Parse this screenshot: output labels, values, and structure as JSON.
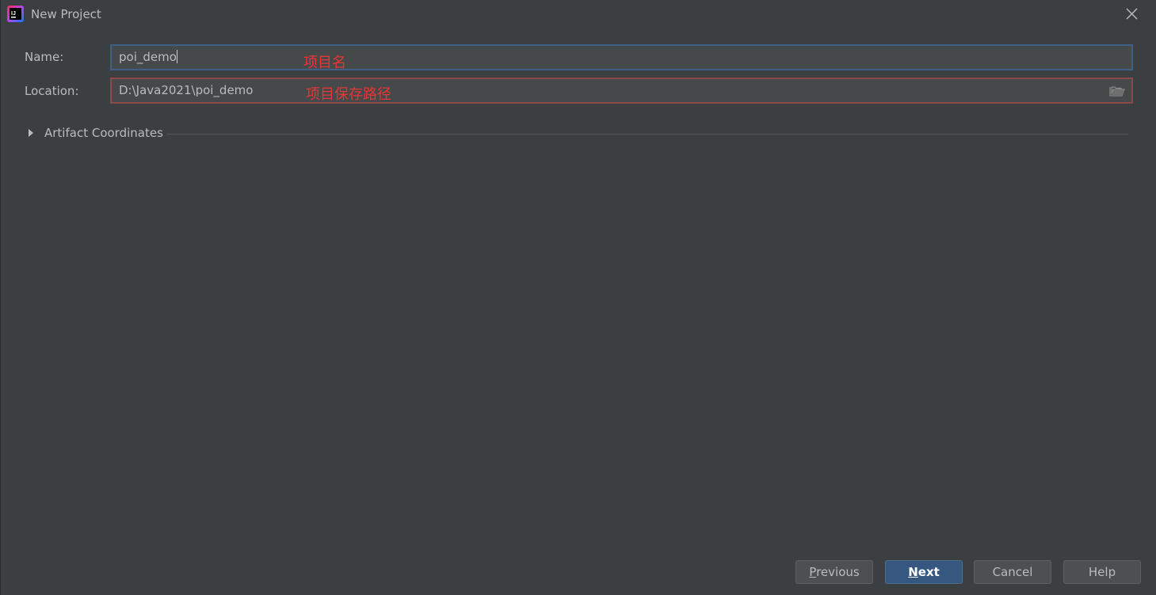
{
  "window": {
    "title": "New Project"
  },
  "form": {
    "name_label": "Name:",
    "name_value": "poi_demo",
    "name_annotation": "项目名",
    "location_label": "Location:",
    "location_value": "D:\\Java2021\\poi_demo",
    "location_annotation": "项目保存路径"
  },
  "artifact_section": {
    "label": "Artifact Coordinates",
    "expanded": false
  },
  "buttons": {
    "previous_mnemonic": "P",
    "previous_rest": "revious",
    "next_mnemonic": "N",
    "next_rest": "ext",
    "cancel": "Cancel",
    "help": "Help"
  },
  "colors": {
    "background": "#3c3f41",
    "field_background": "#45494a",
    "name_border": "#3d6185",
    "location_border": "#8a4a4a",
    "annotation_text": "#e83535",
    "primary_button": "#365880"
  },
  "icons": {
    "app": "intellij-idea-icon",
    "close": "close-icon",
    "browse": "folder-icon",
    "expand": "triangle-right-icon"
  }
}
